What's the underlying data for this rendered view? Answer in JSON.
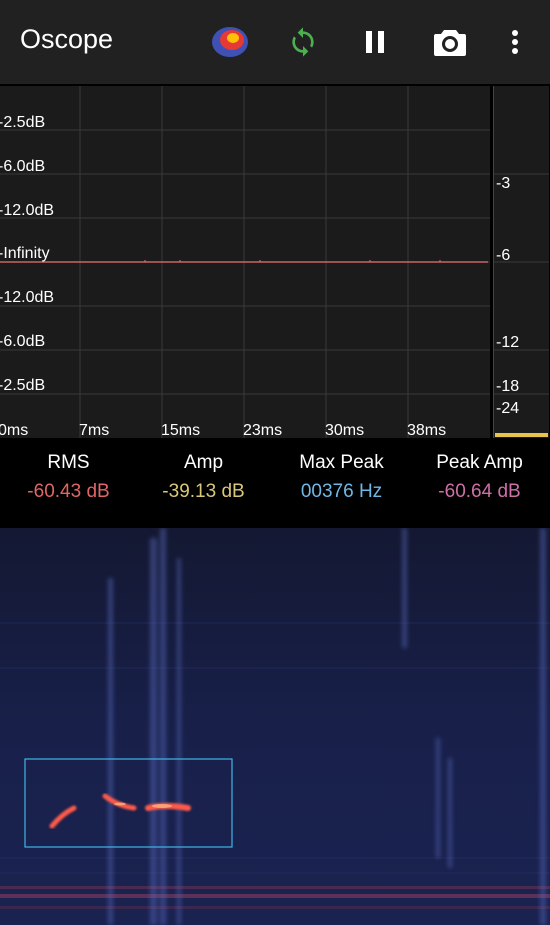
{
  "app": {
    "title": "Oscope"
  },
  "toolbar": {
    "icons": [
      "heatmap-icon",
      "sync-icon",
      "pause-icon",
      "camera-icon",
      "more-vert-icon"
    ],
    "colors": {
      "sync": "#4caf50",
      "heat_outer": "#3f51b5",
      "heat_mid": "#e53935",
      "heat_inner": "#ffc107"
    }
  },
  "oscilloscope": {
    "y_labels": [
      "-2.5dB",
      "-6.0dB",
      "-12.0dB",
      "-Infinity",
      "-12.0dB",
      "-6.0dB",
      "-2.5dB"
    ],
    "x_labels": [
      "0ms",
      "7ms",
      "15ms",
      "23ms",
      "30ms",
      "38ms"
    ],
    "trace_color": "#e57373"
  },
  "level_meter": {
    "labels": [
      "-3",
      "-6",
      "-12",
      "-18",
      "-24"
    ],
    "bar_color": "#e6c54a"
  },
  "stats": {
    "rms": {
      "label": "RMS",
      "value": "-60.43 dB",
      "color": "#e06666"
    },
    "amp": {
      "label": "Amp",
      "value": "-39.13 dB",
      "color": "#d9c77a"
    },
    "max_peak": {
      "label": "Max Peak",
      "value": "00376 Hz",
      "color": "#6fb8e6"
    },
    "peak_amp": {
      "label": "Peak Amp",
      "value": "-60.64 dB",
      "color": "#cf6fa8"
    }
  },
  "spectrogram": {
    "background": "#141a3c",
    "selection_color": "#3fb6e6"
  }
}
